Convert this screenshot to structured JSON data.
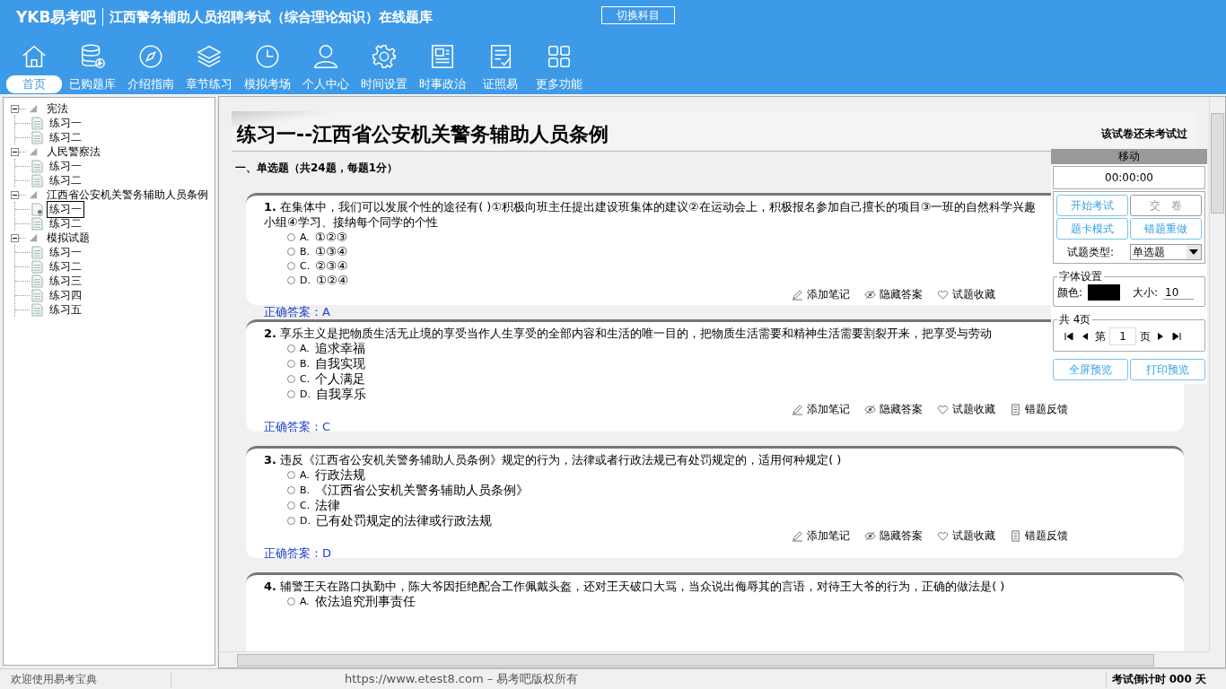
{
  "header": {
    "logo": "YKB易考吧",
    "title": "江西警务辅助人员招聘考试（综合理论知识）在线题库",
    "switch_button": "切换科目"
  },
  "nav": [
    {
      "label": "首页",
      "kind": "home",
      "selected": true
    },
    {
      "label": "已购题库",
      "kind": "database",
      "selected": false
    },
    {
      "label": "介绍指南",
      "kind": "compass",
      "selected": false
    },
    {
      "label": "章节练习",
      "kind": "layers",
      "selected": false
    },
    {
      "label": "模拟考场",
      "kind": "clock",
      "selected": false
    },
    {
      "label": "个人中心",
      "kind": "user",
      "selected": false
    },
    {
      "label": "时间设置",
      "kind": "gear",
      "selected": false
    },
    {
      "label": "时事政治",
      "kind": "news",
      "selected": false
    },
    {
      "label": "证照易",
      "kind": "checklist",
      "selected": false
    },
    {
      "label": "更多功能",
      "kind": "grid",
      "selected": false
    }
  ],
  "tree": [
    {
      "label": "宪法",
      "expanded": true,
      "children": [
        {
          "label": "练习一",
          "selected": false
        },
        {
          "label": "练习二",
          "selected": false
        }
      ]
    },
    {
      "label": "人民警察法",
      "expanded": true,
      "children": [
        {
          "label": "练习一",
          "selected": false
        },
        {
          "label": "练习二",
          "selected": false
        }
      ]
    },
    {
      "label": "江西省公安机关警务辅助人员条例",
      "expanded": true,
      "children": [
        {
          "label": "练习一",
          "selected": true
        },
        {
          "label": "练习二",
          "selected": false
        }
      ]
    },
    {
      "label": "模拟试题",
      "expanded": true,
      "children": [
        {
          "label": "练习一",
          "selected": false
        },
        {
          "label": "练习二",
          "selected": false
        },
        {
          "label": "练习三",
          "selected": false
        },
        {
          "label": "练习四",
          "selected": false
        },
        {
          "label": "练习五",
          "selected": false
        }
      ]
    }
  ],
  "exam": {
    "title": "练习一--江西省公安机关警务辅助人员条例",
    "status": "该试卷还未考试过",
    "section": "一、单选题（共24题，每题1分）",
    "questions": [
      {
        "number": "1.",
        "text": "在集体中，我们可以发展个性的途径有( )①积极向班主任提出建设班集体的建议②在运动会上，积极报名参加自己擅长的项目③一班的自然科学兴趣小组④学习、接纳每个同学的个性",
        "options": [
          {
            "label": "A.",
            "text": "①②③",
            "selected": false
          },
          {
            "label": "B.",
            "text": "①③④",
            "selected": false
          },
          {
            "label": "C.",
            "text": "②③④",
            "selected": false
          },
          {
            "label": "D.",
            "text": "①②④",
            "selected": false
          }
        ],
        "actions": [
          "添加笔记",
          "隐藏答案",
          "试题收藏"
        ],
        "answer": "正确答案：A"
      },
      {
        "number": "2.",
        "text": "享乐主义是把物质生活无止境的享受当作人生享受的全部内容和生活的唯一目的，把物质生活需要和精神生活需要割裂开来，把享受与劳动",
        "options": [
          {
            "label": "A.",
            "text": "追求幸福",
            "selected": false
          },
          {
            "label": "B.",
            "text": "自我实现",
            "selected": false
          },
          {
            "label": "C.",
            "text": "个人满足",
            "selected": false
          },
          {
            "label": "D.",
            "text": "自我享乐",
            "selected": false
          }
        ],
        "actions": [
          "添加笔记",
          "隐藏答案",
          "试题收藏",
          "错题反馈"
        ],
        "answer": "正确答案：C"
      },
      {
        "number": "3.",
        "text": "违反《江西省公安机关警务辅助人员条例》规定的行为，法律或者行政法规已有处罚规定的，适用何种规定( )",
        "options": [
          {
            "label": "A.",
            "text": "行政法规",
            "selected": false
          },
          {
            "label": "B.",
            "text": "《江西省公安机关警务辅助人员条例》",
            "selected": false
          },
          {
            "label": "C.",
            "text": "法律",
            "selected": false
          },
          {
            "label": "D.",
            "text": "已有处罚规定的法律或行政法规",
            "selected": false
          }
        ],
        "actions": [
          "添加笔记",
          "隐藏答案",
          "试题收藏",
          "错题反馈"
        ],
        "answer": "正确答案：D"
      },
      {
        "number": "4.",
        "text": "辅警王天在路口执勤中，陈大爷因拒绝配合工作佩戴头盔，还对王天破口大骂，当众说出侮辱其的言语，对待王大爷的行为，正确的做法是( )",
        "options": [
          {
            "label": "A.",
            "text": "依法追究刑事责任",
            "selected": false
          }
        ]
      }
    ]
  },
  "panel": {
    "header": "移动",
    "timer": "00:00:00",
    "buttons": [
      {
        "label": "开始考试",
        "disabled": false
      },
      {
        "label": "交　卷",
        "disabled": true
      },
      {
        "label": "题卡模式",
        "disabled": false
      },
      {
        "label": "错题重做",
        "disabled": false
      }
    ],
    "type_label": "试题类型:",
    "type_value": "单选题",
    "font_group": "字体设置",
    "color_label": "颜色:",
    "color": "#000000",
    "size_label": "大小:",
    "size_value": "10",
    "pages_label": "共 4页",
    "page_prefix": "第",
    "page_value": "1",
    "page_suffix": "页",
    "preview_buttons": [
      "全屏预览",
      "打印预览"
    ]
  },
  "status_bar": {
    "left": "欢迎使用易考宝典",
    "center": "https://www.etest8.com – 易考吧版权所有",
    "right": "考试倒计时 000 天"
  }
}
